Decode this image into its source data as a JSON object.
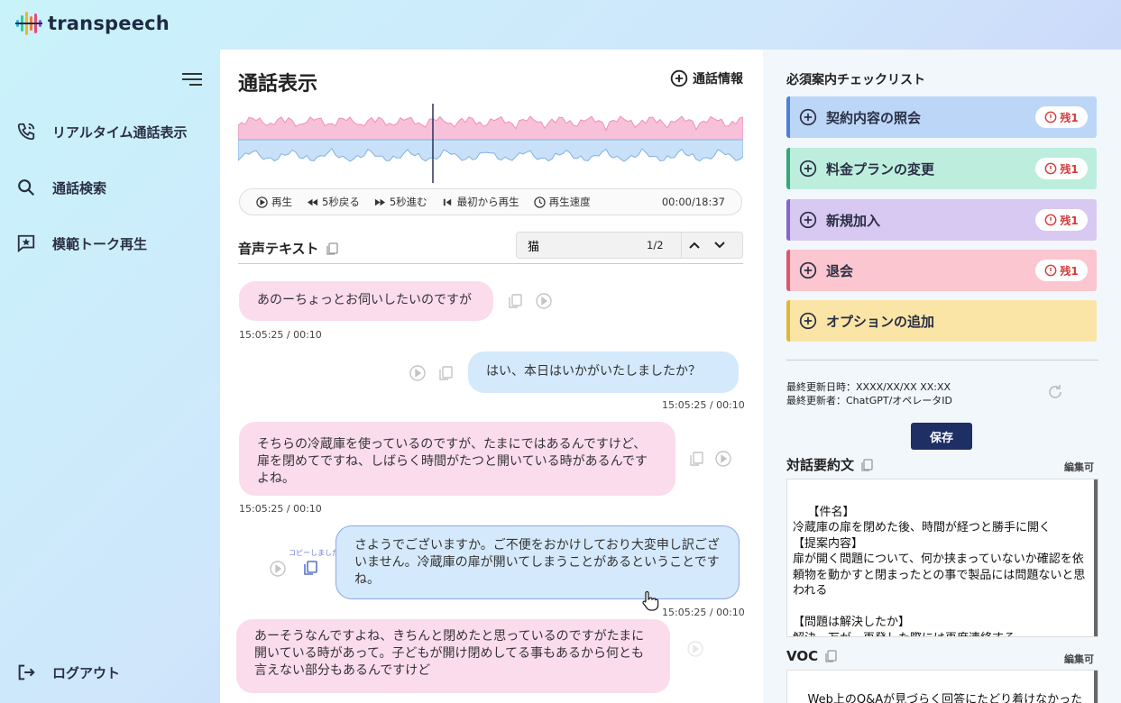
{
  "app": {
    "name": "transpeech"
  },
  "sidebar": {
    "items": [
      {
        "label": "リアルタイム通話表示",
        "icon": "phone-icon"
      },
      {
        "label": "通話検索",
        "icon": "search-icon"
      },
      {
        "label": "模範トーク再生",
        "icon": "star-icon"
      }
    ],
    "logout_label": "ログアウト"
  },
  "main": {
    "title": "通話表示",
    "call_info_label": "通話情報",
    "player": {
      "play": "再生",
      "back5": "5秒戻る",
      "forward5": "5秒進む",
      "from_start": "最初から再生",
      "speed": "再生速度",
      "time": "00:00/18:37",
      "playhead_fraction": 0
    },
    "speech_title": "音声テキスト",
    "search": {
      "value": "猫",
      "count": "1/2"
    },
    "messages": [
      {
        "speaker": "customer",
        "text": "あのーちょっとお伺いしたいのですが",
        "time": "15:05:25 / 00:10"
      },
      {
        "speaker": "operator",
        "text": "はい、本日はいかがいたしましたか？",
        "time": "15:05:25 / 00:10"
      },
      {
        "speaker": "customer",
        "text": "そちらの冷蔵庫を使っているのですが、たまにではあるんですけど、扉を閉めてですね、しばらく時間がたつと開いている時があるんですよね。",
        "time": "15:05:25 / 00:10"
      },
      {
        "speaker": "operator",
        "text": "さようでございますか。ご不便をおかけしており大変申し訳ございません。冷蔵庫の扉が開いてしまうことがあるということですね。",
        "time": "15:05:25 / 00:10",
        "copied_label": "コピーしました"
      },
      {
        "speaker": "customer",
        "text": "あーそうなんですよね、きちんと閉めたと思っているのですがたまに開いている時があって。子どもが開け閉めしてる事もあるから何とも言えない部分もあるんですけど",
        "time": ""
      }
    ]
  },
  "right": {
    "checklist_title": "必須案内チェックリスト",
    "checklist": [
      {
        "label": "契約内容の照会",
        "remain": "残1",
        "bg": "#bcd6f7",
        "bar": "#4f7fd8"
      },
      {
        "label": "料金プランの変更",
        "remain": "残1",
        "bg": "#bdeedd",
        "bar": "#32a878"
      },
      {
        "label": "新規加入",
        "remain": "残1",
        "bg": "#d7c9f2",
        "bar": "#8465cc"
      },
      {
        "label": "退会",
        "remain": "残1",
        "bg": "#fbc6cf",
        "bar": "#e0566f"
      },
      {
        "label": "オプションの追加",
        "remain": "",
        "bg": "#fbe5a6",
        "bar": "#e4b536"
      }
    ],
    "updated_at": "最終更新日時：XXXX/XX/XX XX:XX",
    "updated_by": "最終更新者：ChatGPT/オペレータID",
    "save_label": "保存",
    "summary_title": "対話要約文",
    "summary_editable": "編集可",
    "summary_text": "【件名】\n冷蔵庫の扉を閉めた後、時間が経つと勝手に開く\n【提案内容】\n扉が開く問題について、何か挟まっていないか確認を依頼物を動かすと閉まったとの事で製品には問題ないと思われる\n\n【問題は解決したか】\n解決。万が一再発した際には再度連絡する",
    "voc_title": "VOC",
    "voc_editable": "編集可",
    "voc_text": "Web上のQ&Aが見づらく回答にたどり着けなかった"
  }
}
